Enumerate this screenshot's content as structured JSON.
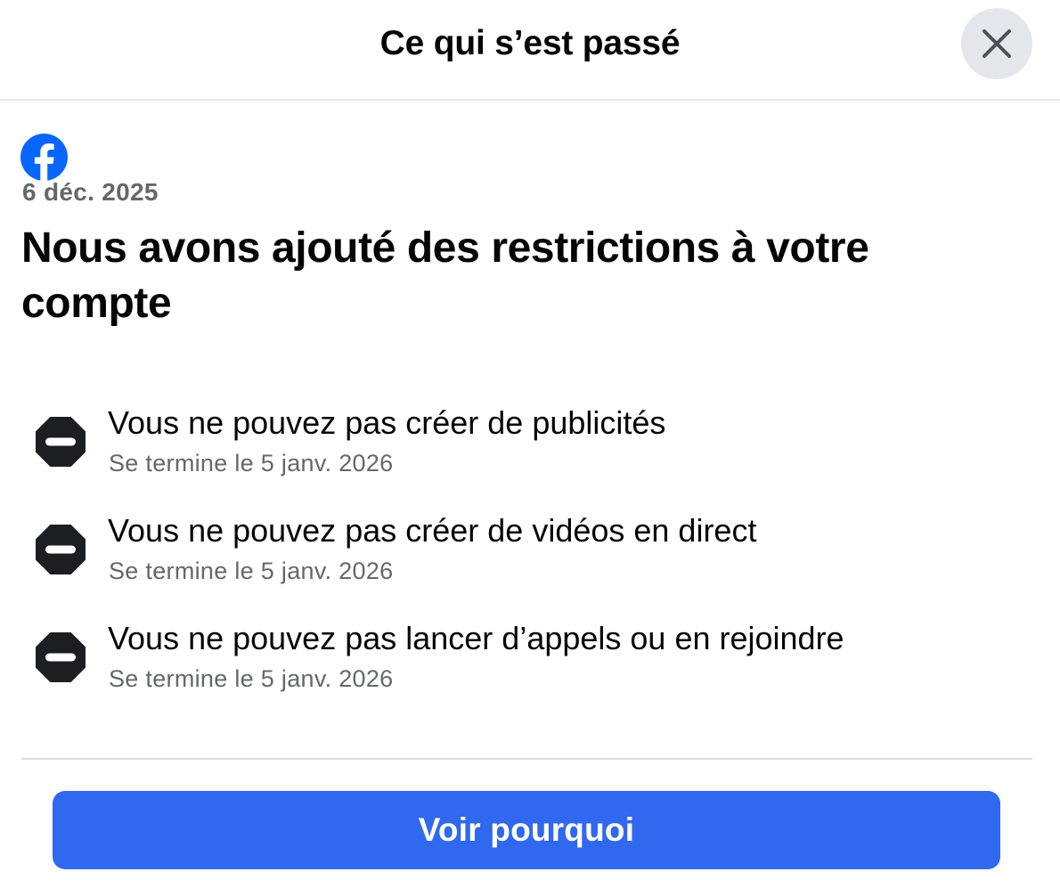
{
  "header": {
    "title": "Ce qui s’est passé",
    "close_icon": "close-icon"
  },
  "notice": {
    "logo_icon": "facebook-logo-icon",
    "date": "6 déc. 2025",
    "headline": "Nous avons ajouté des restrictions à votre compte"
  },
  "restrictions": [
    {
      "icon": "stop-sign-icon",
      "title": "Vous ne pouvez pas créer de publicités",
      "ends": "Se termine le 5 janv. 2026"
    },
    {
      "icon": "stop-sign-icon",
      "title": "Vous ne pouvez pas créer de vidéos en direct",
      "ends": "Se termine le 5 janv. 2026"
    },
    {
      "icon": "stop-sign-icon",
      "title": "Vous ne pouvez pas lancer d’appels ou en rejoindre",
      "ends": "Se termine le 5 janv. 2026"
    }
  ],
  "footer": {
    "button_label": "Voir pourquoi"
  },
  "colors": {
    "accent": "#3068f0",
    "facebook_blue": "#0866ff",
    "secondary_text": "#65676b",
    "stop_icon": "#1c1e21"
  }
}
